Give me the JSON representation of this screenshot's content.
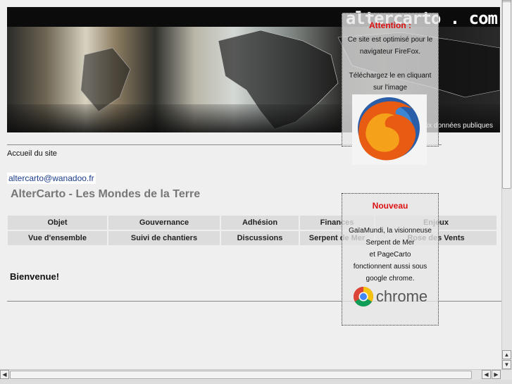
{
  "banner": {
    "logo_text": "altercarto . com",
    "tagline": "Vers l'accès libre aux données publiques"
  },
  "breadcrumb": "Accueil du site",
  "email": "altercarto@wanadoo.fr",
  "site_title": "AlterCarto - Les Mondes de la Terre",
  "menu": {
    "row1": [
      "Objet",
      "Gouvernance",
      "Adhésion",
      "Finances",
      "Enjeux"
    ],
    "row2": [
      "Vue d'ensemble",
      "Suivi de chantiers",
      "Discussions",
      "Serpent de Mer",
      "Rose des Vents"
    ]
  },
  "welcome": "Bienvenue!",
  "notice_firefox": {
    "heading": "Attention :",
    "line1": "Ce site est optimisé pour le",
    "line2": "navigateur FireFox.",
    "line3": "Téléchargez le en cliquant",
    "line4": "sur l'image"
  },
  "notice_chrome": {
    "heading": "Nouveau",
    "line1": "GaïaMundi, la visionneuse",
    "line2": "Serpent de Mer",
    "line3": "et PageCarto",
    "line4": "fonctionnent aussi sous",
    "line5": "google chrome.",
    "logo_word": "chrome"
  },
  "colors": {
    "alert": "#dd1111",
    "link": "#1a3c8a",
    "menu_bg": "#dcdcdc"
  }
}
